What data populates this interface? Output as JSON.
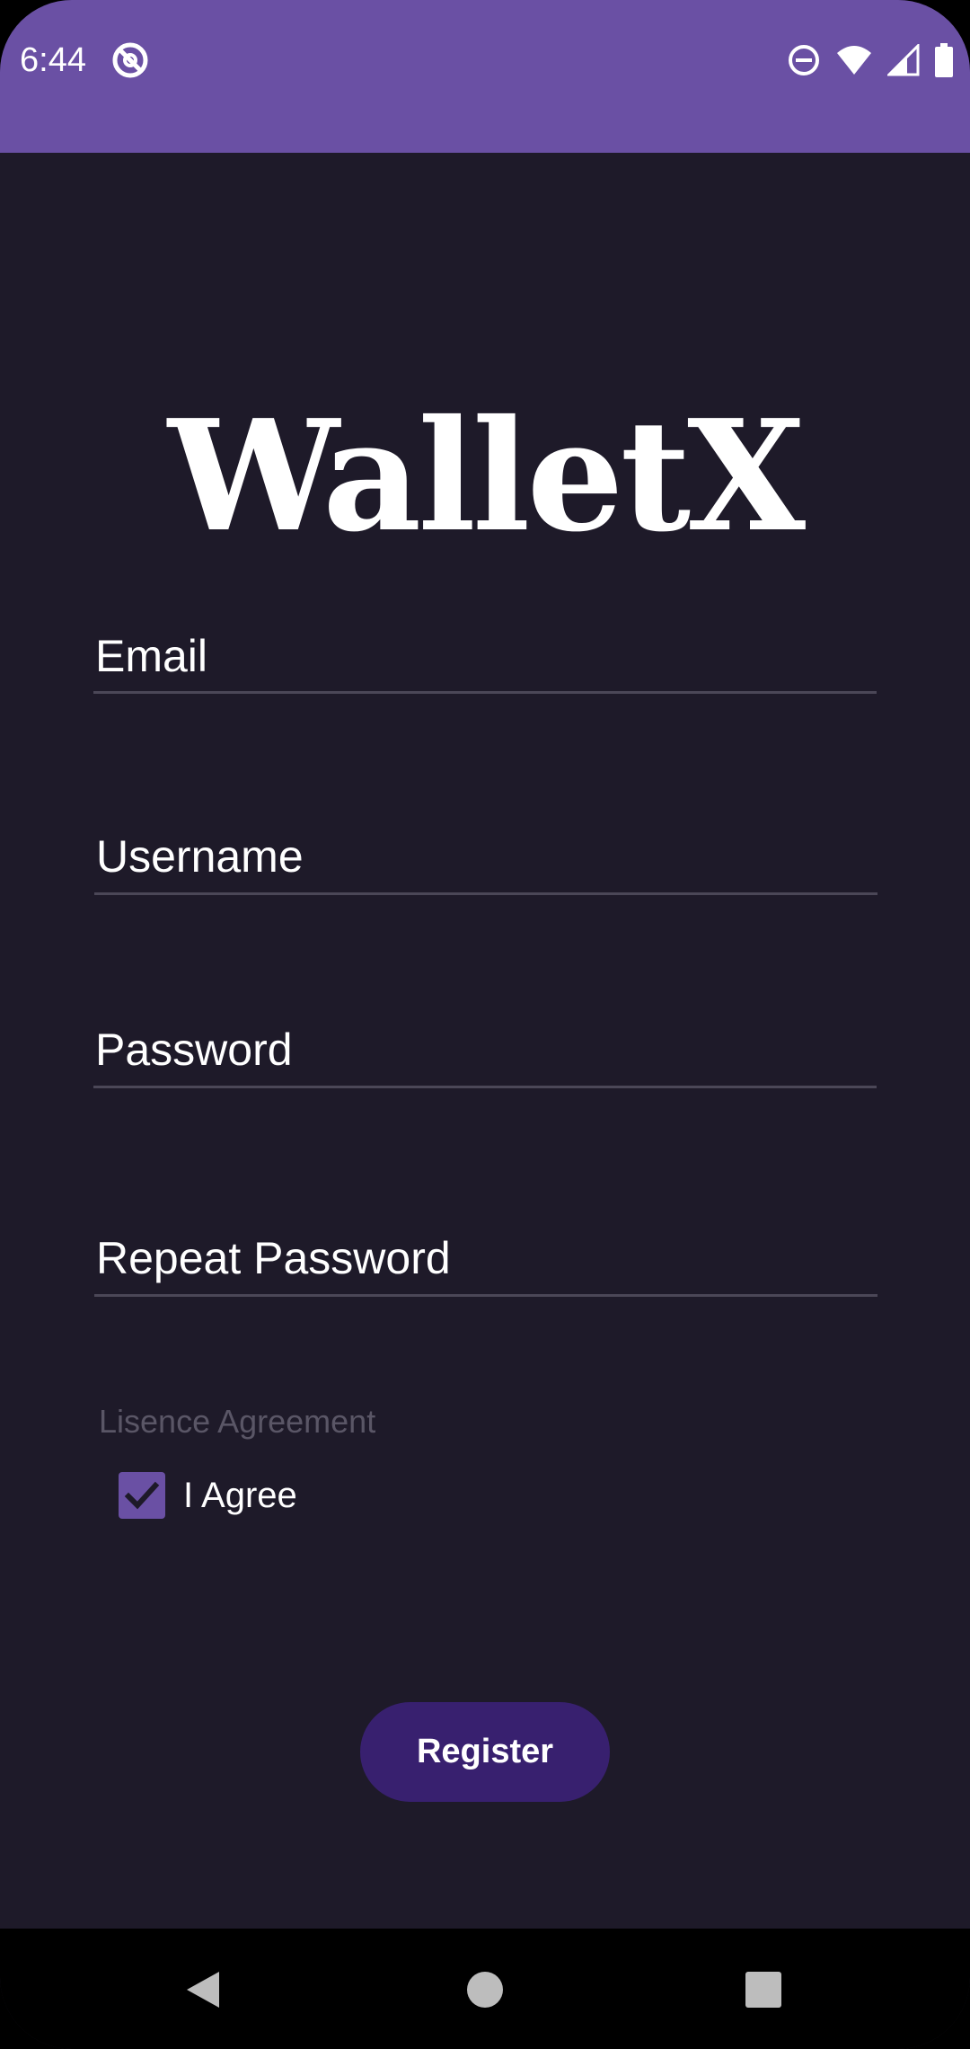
{
  "status_bar": {
    "time": "6:44",
    "left_icon": "at-sign-crossed-icon",
    "right_icons": [
      "do-not-disturb-icon",
      "wifi-icon",
      "signal-icon",
      "battery-icon"
    ]
  },
  "app": {
    "logo_text": "WalletX"
  },
  "form": {
    "email_placeholder": "Email",
    "username_placeholder": "Username",
    "password_placeholder": "Password",
    "repeat_password_placeholder": "Repeat Password",
    "license_label": "Lisence Agreement",
    "agree_label": "I Agree",
    "agree_checked": true,
    "register_label": "Register"
  },
  "colors": {
    "status_bar": "#6a50a4",
    "background": "#1e1a29",
    "accent": "#6a50a4",
    "button": "#38206f",
    "underline": "#4b4757"
  },
  "nav_bar": {
    "icons": [
      "back-triangle-icon",
      "home-circle-icon",
      "recents-square-icon"
    ]
  }
}
